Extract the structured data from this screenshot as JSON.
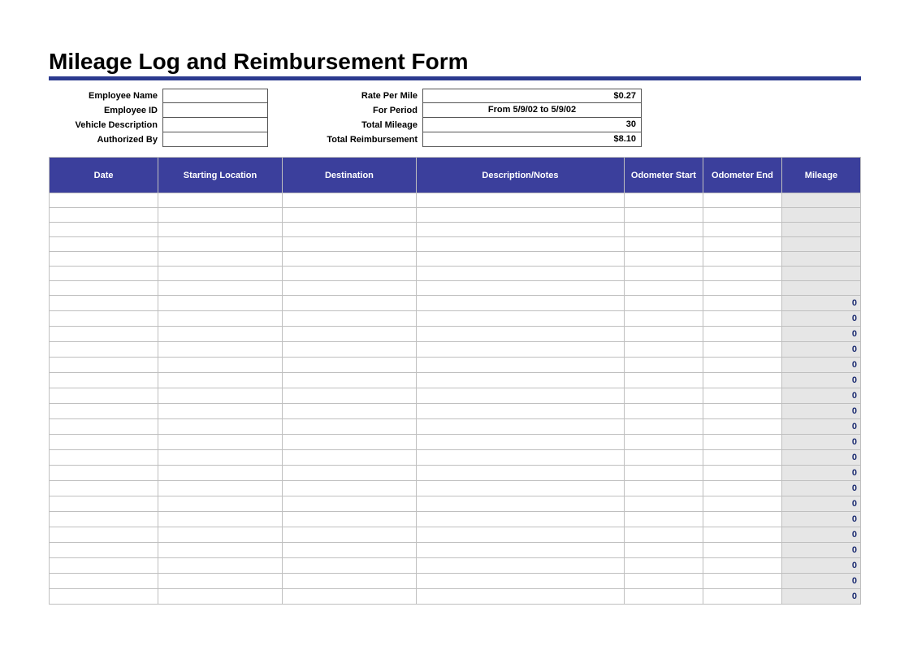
{
  "title": "Mileage Log and Reimbursement Form",
  "header": {
    "left": {
      "employee_name_label": "Employee Name",
      "employee_name_value": "",
      "employee_id_label": "Employee ID",
      "employee_id_value": "",
      "vehicle_desc_label": "Vehicle Description",
      "vehicle_desc_value": "",
      "authorized_by_label": "Authorized By",
      "authorized_by_value": ""
    },
    "right": {
      "rate_label": "Rate Per Mile",
      "rate_value": "$0.27",
      "for_period_label": "For Period",
      "for_period_value": "From 5/9/02 to 5/9/02",
      "total_mileage_label": "Total Mileage",
      "total_mileage_value": "30",
      "total_reimb_label": "Total Reimbursement",
      "total_reimb_value": "$8.10"
    }
  },
  "columns": {
    "date": "Date",
    "start": "Starting Location",
    "dest": "Destination",
    "desc": "Description/Notes",
    "od_start": "Odometer Start",
    "od_end": "Odometer End",
    "mileage": "Mileage"
  },
  "rows": [
    {
      "date": "",
      "start": "",
      "dest": "",
      "desc": "",
      "od_start": "",
      "od_end": "",
      "mileage": ""
    },
    {
      "date": "",
      "start": "",
      "dest": "",
      "desc": "",
      "od_start": "",
      "od_end": "",
      "mileage": ""
    },
    {
      "date": "",
      "start": "",
      "dest": "",
      "desc": "",
      "od_start": "",
      "od_end": "",
      "mileage": ""
    },
    {
      "date": "",
      "start": "",
      "dest": "",
      "desc": "",
      "od_start": "",
      "od_end": "",
      "mileage": ""
    },
    {
      "date": "",
      "start": "",
      "dest": "",
      "desc": "",
      "od_start": "",
      "od_end": "",
      "mileage": ""
    },
    {
      "date": "",
      "start": "",
      "dest": "",
      "desc": "",
      "od_start": "",
      "od_end": "",
      "mileage": ""
    },
    {
      "date": "",
      "start": "",
      "dest": "",
      "desc": "",
      "od_start": "",
      "od_end": "",
      "mileage": ""
    },
    {
      "date": "",
      "start": "",
      "dest": "",
      "desc": "",
      "od_start": "",
      "od_end": "",
      "mileage": "0"
    },
    {
      "date": "",
      "start": "",
      "dest": "",
      "desc": "",
      "od_start": "",
      "od_end": "",
      "mileage": "0"
    },
    {
      "date": "",
      "start": "",
      "dest": "",
      "desc": "",
      "od_start": "",
      "od_end": "",
      "mileage": "0"
    },
    {
      "date": "",
      "start": "",
      "dest": "",
      "desc": "",
      "od_start": "",
      "od_end": "",
      "mileage": "0"
    },
    {
      "date": "",
      "start": "",
      "dest": "",
      "desc": "",
      "od_start": "",
      "od_end": "",
      "mileage": "0"
    },
    {
      "date": "",
      "start": "",
      "dest": "",
      "desc": "",
      "od_start": "",
      "od_end": "",
      "mileage": "0"
    },
    {
      "date": "",
      "start": "",
      "dest": "",
      "desc": "",
      "od_start": "",
      "od_end": "",
      "mileage": "0"
    },
    {
      "date": "",
      "start": "",
      "dest": "",
      "desc": "",
      "od_start": "",
      "od_end": "",
      "mileage": "0"
    },
    {
      "date": "",
      "start": "",
      "dest": "",
      "desc": "",
      "od_start": "",
      "od_end": "",
      "mileage": "0"
    },
    {
      "date": "",
      "start": "",
      "dest": "",
      "desc": "",
      "od_start": "",
      "od_end": "",
      "mileage": "0"
    },
    {
      "date": "",
      "start": "",
      "dest": "",
      "desc": "",
      "od_start": "",
      "od_end": "",
      "mileage": "0"
    },
    {
      "date": "",
      "start": "",
      "dest": "",
      "desc": "",
      "od_start": "",
      "od_end": "",
      "mileage": "0"
    },
    {
      "date": "",
      "start": "",
      "dest": "",
      "desc": "",
      "od_start": "",
      "od_end": "",
      "mileage": "0"
    },
    {
      "date": "",
      "start": "",
      "dest": "",
      "desc": "",
      "od_start": "",
      "od_end": "",
      "mileage": "0"
    },
    {
      "date": "",
      "start": "",
      "dest": "",
      "desc": "",
      "od_start": "",
      "od_end": "",
      "mileage": "0"
    },
    {
      "date": "",
      "start": "",
      "dest": "",
      "desc": "",
      "od_start": "",
      "od_end": "",
      "mileage": "0"
    },
    {
      "date": "",
      "start": "",
      "dest": "",
      "desc": "",
      "od_start": "",
      "od_end": "",
      "mileage": "0"
    },
    {
      "date": "",
      "start": "",
      "dest": "",
      "desc": "",
      "od_start": "",
      "od_end": "",
      "mileage": "0"
    },
    {
      "date": "",
      "start": "",
      "dest": "",
      "desc": "",
      "od_start": "",
      "od_end": "",
      "mileage": "0"
    },
    {
      "date": "",
      "start": "",
      "dest": "",
      "desc": "",
      "od_start": "",
      "od_end": "",
      "mileage": "0"
    }
  ]
}
